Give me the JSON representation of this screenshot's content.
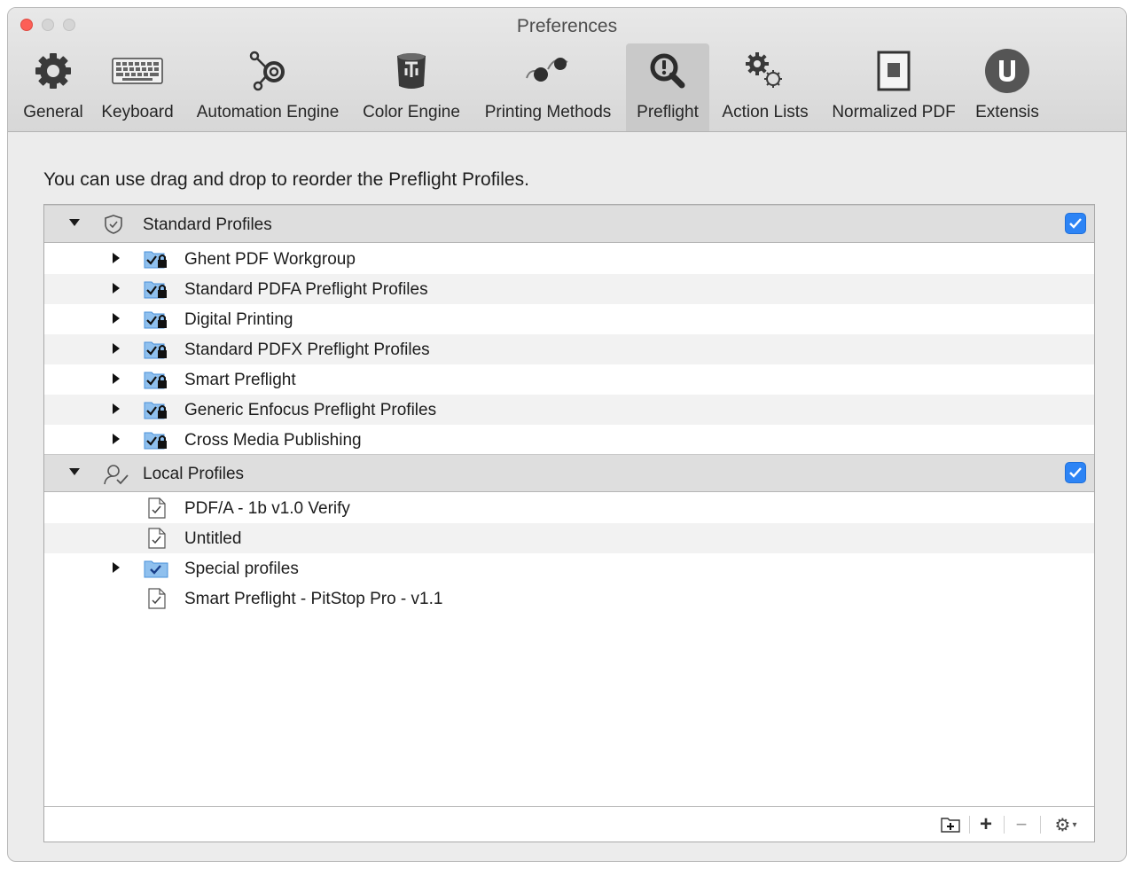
{
  "window": {
    "title": "Preferences"
  },
  "toolbar": {
    "items": [
      {
        "label": "General",
        "icon": "gear-icon"
      },
      {
        "label": "Keyboard",
        "icon": "keyboard-icon"
      },
      {
        "label": "Automation Engine",
        "icon": "automation-engine-icon"
      },
      {
        "label": "Color Engine",
        "icon": "color-engine-icon"
      },
      {
        "label": "Printing Methods",
        "icon": "printing-methods-icon"
      },
      {
        "label": "Preflight",
        "icon": "preflight-magnifier-icon",
        "selected": true
      },
      {
        "label": "Action Lists",
        "icon": "action-lists-gears-icon"
      },
      {
        "label": "Normalized PDF",
        "icon": "normalized-pdf-icon"
      },
      {
        "label": "Extensis",
        "icon": "extensis-logo-icon"
      }
    ]
  },
  "main": {
    "hint": "You can use drag and drop to reorder the Preflight Profiles.",
    "sections": [
      {
        "label": "Standard Profiles",
        "checked": true,
        "rows": [
          {
            "label": "Ghent PDF Workgroup"
          },
          {
            "label": "Standard PDFA Preflight Profiles"
          },
          {
            "label": "Digital Printing"
          },
          {
            "label": "Standard PDFX Preflight Profiles"
          },
          {
            "label": "Smart Preflight"
          },
          {
            "label": "Generic Enfocus Preflight Profiles"
          },
          {
            "label": "Cross Media Publishing"
          }
        ]
      },
      {
        "label": "Local Profiles",
        "checked": true,
        "rows": [
          {
            "label": "PDF/A - 1b v1.0 Verify"
          },
          {
            "label": "Untitled"
          },
          {
            "label": "Special profiles"
          },
          {
            "label": "Smart Preflight - PitStop Pro - v1.1"
          }
        ]
      }
    ]
  },
  "bottom_bar": {
    "add_folder": "+",
    "add": "+",
    "remove": "−",
    "actions_menu": "⚙"
  },
  "colors": {
    "accent": "#2d84f5",
    "close": "#fd5f57",
    "selected_toolbar": "#c9c9c9"
  }
}
